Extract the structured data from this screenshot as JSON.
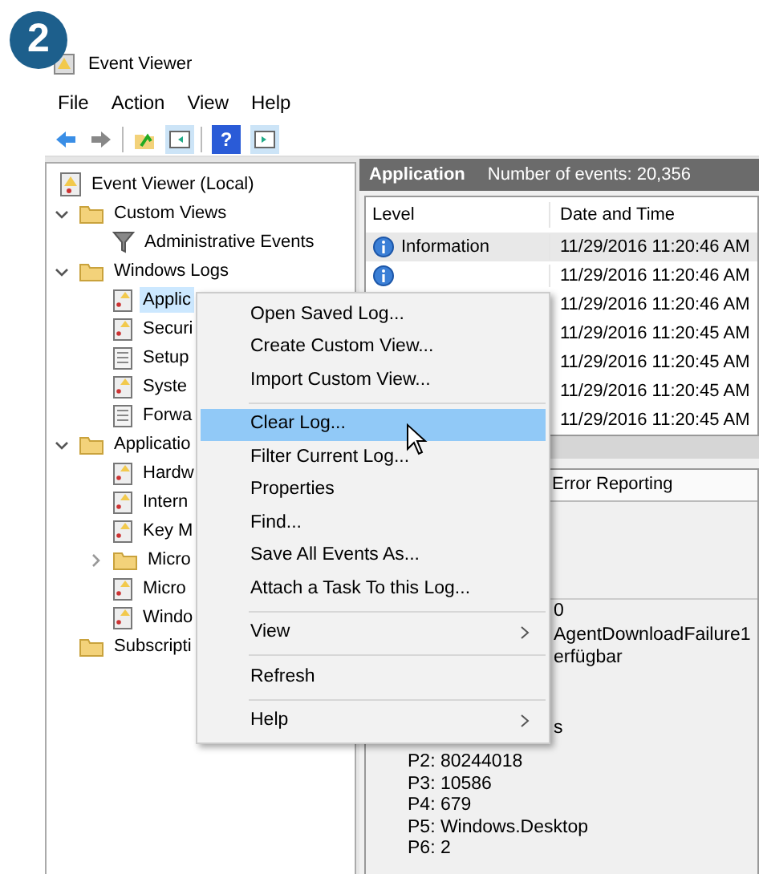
{
  "step_badge": "2",
  "window": {
    "title": "Event Viewer"
  },
  "menu_bar": [
    "File",
    "Action",
    "View",
    "Help"
  ],
  "toolbar": {
    "help_glyph": "?"
  },
  "tree": [
    {
      "label": "Event Viewer (Local)",
      "kind": "root",
      "selected": false,
      "children": [
        {
          "label": "Custom Views",
          "kind": "folder",
          "expanded": true,
          "selected": false,
          "children": [
            {
              "label": "Administrative Events",
              "kind": "filter",
              "selected": false
            }
          ]
        },
        {
          "label": "Windows Logs",
          "kind": "folder",
          "expanded": true,
          "selected": false,
          "children": [
            {
              "label": "Applic",
              "kind": "log",
              "selected": true
            },
            {
              "label": "Securi",
              "kind": "log",
              "selected": false
            },
            {
              "label": "Setup",
              "kind": "plainlog",
              "selected": false
            },
            {
              "label": "Syste",
              "kind": "log",
              "selected": false
            },
            {
              "label": "Forwa",
              "kind": "plainlog",
              "selected": false
            }
          ]
        },
        {
          "label": "Applicatio",
          "kind": "folder",
          "expanded": true,
          "selected": false,
          "children": [
            {
              "label": "Hardw",
              "kind": "log",
              "selected": false
            },
            {
              "label": "Intern",
              "kind": "log",
              "selected": false
            },
            {
              "label": "Key M",
              "kind": "log",
              "selected": false
            },
            {
              "label": "Micro",
              "kind": "folder",
              "expanded": false,
              "selected": false
            },
            {
              "label": "Micro",
              "kind": "log",
              "selected": false
            },
            {
              "label": "Windo",
              "kind": "log",
              "selected": false
            }
          ]
        },
        {
          "label": "Subscripti",
          "kind": "folder",
          "selected": false
        }
      ]
    }
  ],
  "log_header": {
    "name": "Application",
    "count": "Number of events: 20,356"
  },
  "table": {
    "columns": [
      "Level",
      "Date and Time"
    ],
    "rows": [
      {
        "level": "Information",
        "time": "11/29/2016 11:20:46 AM",
        "selected": true
      },
      {
        "level": "",
        "time": "11/29/2016 11:20:46 AM",
        "selected": false
      },
      {
        "level": "",
        "time": "11/29/2016 11:20:46 AM",
        "selected": false
      },
      {
        "level": "",
        "time": "11/29/2016 11:20:45 AM",
        "selected": false
      },
      {
        "level": "",
        "time": "11/29/2016 11:20:45 AM",
        "selected": false
      },
      {
        "level": "",
        "time": "11/29/2016 11:20:45 AM",
        "selected": false
      },
      {
        "level": "",
        "time": "11/29/2016 11:20:45 AM",
        "selected": false
      }
    ]
  },
  "detail": {
    "source": "Error Reporting",
    "lines": [
      "0",
      "AgentDownloadFailure1",
      "erfügbar",
      "s"
    ],
    "params": [
      "P2: 80244018",
      "P3: 10586",
      "P4: 679",
      "P5: Windows.Desktop",
      "P6: 2"
    ]
  },
  "context_menu": [
    {
      "kind": "item",
      "label": "Open Saved Log...",
      "selected": false
    },
    {
      "kind": "item",
      "label": "Create Custom View...",
      "selected": false
    },
    {
      "kind": "item",
      "label": "Import Custom View...",
      "selected": false
    },
    {
      "kind": "separator"
    },
    {
      "kind": "item",
      "label": "Clear Log...",
      "selected": true
    },
    {
      "kind": "item",
      "label": "Filter Current Log...",
      "selected": false
    },
    {
      "kind": "item",
      "label": "Properties",
      "selected": false
    },
    {
      "kind": "item",
      "label": "Find...",
      "selected": false
    },
    {
      "kind": "item",
      "label": "Save All Events As...",
      "selected": false
    },
    {
      "kind": "item",
      "label": "Attach a Task To this Log...",
      "selected": false
    },
    {
      "kind": "separator"
    },
    {
      "kind": "submenu",
      "label": "View",
      "selected": false
    },
    {
      "kind": "separator"
    },
    {
      "kind": "item",
      "label": "Refresh",
      "selected": false
    },
    {
      "kind": "separator"
    },
    {
      "kind": "submenu",
      "label": "Help",
      "selected": false
    }
  ]
}
